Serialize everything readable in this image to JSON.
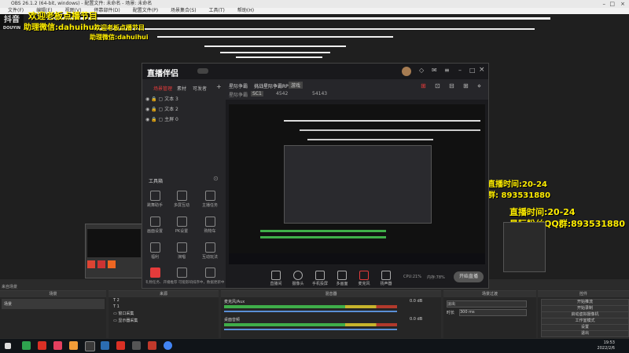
{
  "obs": {
    "title": "OBS 26.1.2 (64-bit, windows) - 配置文件: 未命名 - 场景: 未命名",
    "menu": [
      "文件(F)",
      "编辑(E)",
      "视图(V)",
      "停靠部件(D)",
      "配置文件(P)",
      "场景集合(S)",
      "工具(T)",
      "帮助(H)"
    ],
    "docks": {
      "scenes_label": "来自场景",
      "scenes_title": "场景",
      "scene_item": "场景",
      "sources_title": "来源",
      "sources": [
        "2",
        "1",
        "窗口采集",
        "显示器采集"
      ],
      "mixer_title": "混音器",
      "mixer_channels": [
        {
          "name": "麦克风/Aux",
          "level": "0.0 dB"
        },
        {
          "name": "桌面音频",
          "level": "0.0 dB"
        }
      ],
      "transitions_title": "场景过渡",
      "transition_value": "淡出",
      "duration_label": "时长",
      "duration_value": "300 ms",
      "controls_title": "控件",
      "controls": [
        "开始推流",
        "开始录制",
        "启动虚拟摄像机",
        "工作室模式",
        "设置",
        "退出"
      ]
    }
  },
  "overlay": {
    "logo": "抖音",
    "logo_sub": "DOUYIN",
    "line1": "欢迎老板点播节目",
    "line2": "助理微信:dahuihui",
    "line3": "欢迎老板点播节目",
    "line4": "助理微信:dahuihui",
    "right_time": "直播时间:20-24",
    "right_qq": "星际粉丝QQ群:893531880",
    "inner_time": "直播时间:20-24",
    "inner_qq": "群: 893531880"
  },
  "companion": {
    "logo": "直播伴侣",
    "tabs": [
      "场景管理",
      "素材",
      "可发者"
    ],
    "scenes": [
      "文本 3",
      "文本 2",
      "主屏 0"
    ],
    "tools_label": "工具箱",
    "tools": [
      "跳舞助手",
      "多屏互动",
      "主播任务",
      "画面设置",
      "PK设置",
      "购物车",
      "福利",
      "演唱",
      "互动玩法",
      "直播间",
      "抖音",
      "更多"
    ],
    "notice": "礼物任务、开播推荐 可能影响排序中，数据更新中",
    "info": {
      "title_prefix": "星际争霸",
      "title": "挑战星际争霸RPG",
      "tag": "游戏",
      "sub_label": "星际争霸",
      "sub_tag": "SC1",
      "viewers": "4542",
      "likes": "54143"
    },
    "bottom_tools": [
      "直播间",
      "摄像头",
      "手机投屏",
      "多画面",
      "麦克风",
      "扬声器"
    ],
    "stats": [
      "CPU:21%",
      "内存:78%"
    ],
    "live_button": "开始直播"
  },
  "taskbar": {
    "time": "19:53",
    "date": "2022/2/6"
  },
  "colors": {
    "accent_red": "#e43b3b",
    "overlay_yellow": "#ffee00",
    "meter_green": "#3fae49"
  }
}
